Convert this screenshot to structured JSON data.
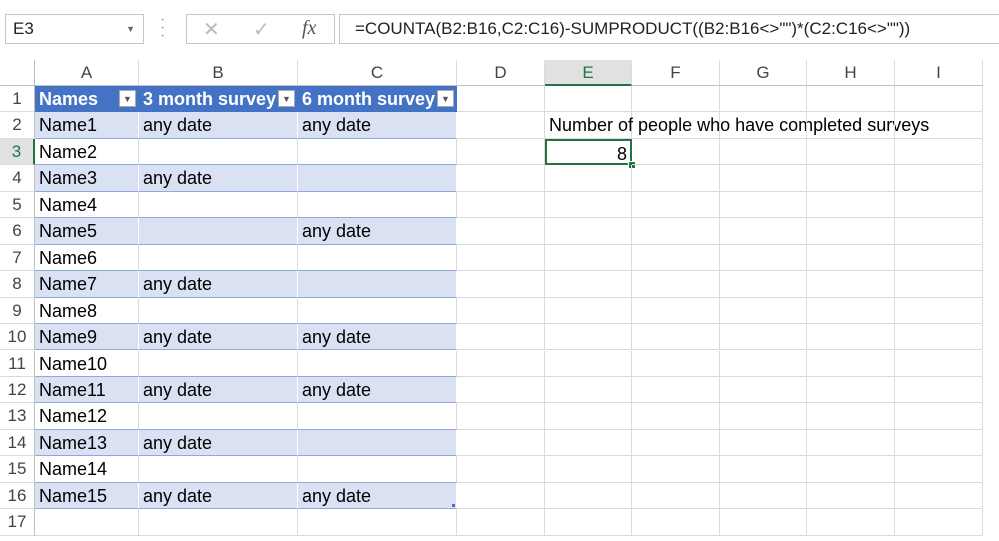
{
  "name_box": "E3",
  "formula_bar": {
    "cancel_icon": "x-icon",
    "enter_icon": "check-icon",
    "fx_label": "fx",
    "formula": "=COUNTA(B2:B16,C2:C16)-SUMPRODUCT((B2:B16<>\"\")*(C2:C16<>\"\"))"
  },
  "columns": [
    "A",
    "B",
    "C",
    "D",
    "E",
    "F",
    "G",
    "H",
    "I"
  ],
  "selected_column": "E",
  "selected_row": 3,
  "table": {
    "headers": [
      "Names",
      "3 month survey",
      "6 month survey"
    ],
    "rows": [
      [
        "Name1",
        "any date",
        "any date"
      ],
      [
        "Name2",
        "",
        ""
      ],
      [
        "Name3",
        "any date",
        ""
      ],
      [
        "Name4",
        "",
        ""
      ],
      [
        "Name5",
        "",
        "any date"
      ],
      [
        "Name6",
        "",
        ""
      ],
      [
        "Name7",
        "any date",
        ""
      ],
      [
        "Name8",
        "",
        ""
      ],
      [
        "Name9",
        "any date",
        "any date"
      ],
      [
        "Name10",
        "",
        ""
      ],
      [
        "Name11",
        "any date",
        "any date"
      ],
      [
        "Name12",
        "",
        ""
      ],
      [
        "Name13",
        "any date",
        ""
      ],
      [
        "Name14",
        "",
        ""
      ],
      [
        "Name15",
        "any date",
        "any date"
      ]
    ]
  },
  "label_cell": {
    "ref": "E2",
    "text": "Number of people who have completed surveys"
  },
  "result_cell": {
    "ref": "E3",
    "value": "8"
  },
  "row_numbers": [
    1,
    2,
    3,
    4,
    5,
    6,
    7,
    8,
    9,
    10,
    11,
    12,
    13,
    14,
    15,
    16,
    17
  ],
  "colors": {
    "table_header": "#4472c4",
    "band": "#d9e1f2",
    "selection": "#217346"
  }
}
